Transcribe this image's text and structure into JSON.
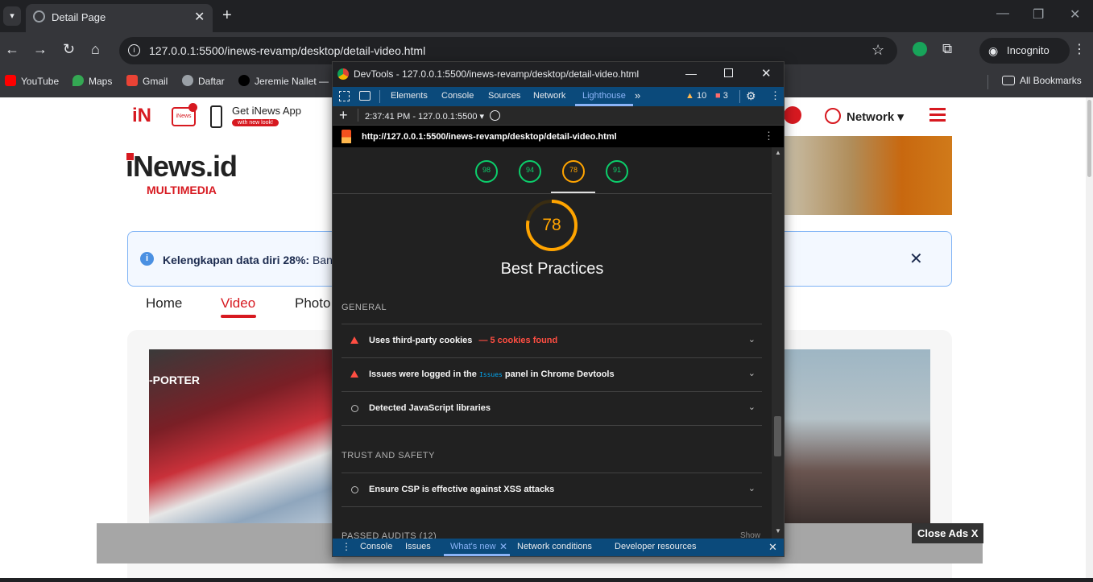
{
  "browser": {
    "tab_title": "Detail Page",
    "url": "127.0.0.1:5500/inews-revamp/desktop/detail-video.html",
    "incognito_label": "Incognito",
    "bookmarks": [
      "YouTube",
      "Maps",
      "Gmail",
      "Daftar",
      "Jeremie Nallet —"
    ],
    "all_bookmarks": "All Bookmarks"
  },
  "site": {
    "logo_small": "iN",
    "app_label": "Get iNews App",
    "app_badge": "with new look!",
    "tv_badge": "iNews",
    "logo_main": "iNews.id",
    "logo_sub": "MULTIMEDIA",
    "network_label": "Network",
    "notice_bold": "Kelengkapan data diri 28%:",
    "notice_rest": " Ban",
    "nav": [
      "Home",
      "Video",
      "Photo"
    ],
    "active_nav": "Video",
    "porter_text": "-PORTER",
    "close_ads": "Close Ads X"
  },
  "devtools": {
    "title": "DevTools - 127.0.0.1:5500/inews-revamp/desktop/detail-video.html",
    "tabs": [
      "Elements",
      "Console",
      "Sources",
      "Network",
      "Lighthouse"
    ],
    "active_tab": "Lighthouse",
    "warnings": "10",
    "errors": "3",
    "report_time": "2:37:41 PM - 127.0.0.1:5500",
    "report_url": "http://127.0.0.1:5500/inews-revamp/desktop/detail-video.html",
    "scores": [
      "98",
      "94",
      "78",
      "91"
    ],
    "main_score": "78",
    "main_category": "Best Practices",
    "group_general": "GENERAL",
    "audits_general": [
      {
        "title": "Uses third-party cookies",
        "extra": "— 5 cookies found",
        "status": "fail"
      },
      {
        "title_pre": "Issues were logged in the ",
        "code": "Issues",
        "title_post": " panel in Chrome Devtools",
        "status": "fail"
      },
      {
        "title": "Detected JavaScript libraries",
        "status": "info"
      }
    ],
    "group_trust": "TRUST AND SAFETY",
    "audits_trust": [
      {
        "title": "Ensure CSP is effective against XSS attacks",
        "status": "info"
      }
    ],
    "passed_label": "PASSED AUDITS (12)",
    "show_label": "Show",
    "drawer_tabs": [
      "Console",
      "Issues",
      "What's new",
      "Network conditions",
      "Developer resources"
    ],
    "active_drawer": "What's new"
  },
  "colors": {
    "accent_red": "#d71920",
    "lh_pass": "#0cce6b",
    "lh_avg": "#ffa400",
    "lh_fail": "#ff4e42",
    "devtools_tabbar": "#0b4a7b"
  }
}
